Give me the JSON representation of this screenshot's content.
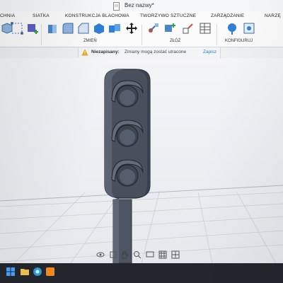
{
  "window": {
    "title": "Bez nazwy*"
  },
  "ribbon": {
    "tabs": [
      "CHNIA",
      "SIATKA",
      "KONSTRUKCJA BLACHOWA",
      "TWORZYWO SZTUCZNE",
      "ZARZĄDZANIE",
      "NARZĘ"
    ],
    "groups": {
      "modify": "ZMIEŃ",
      "assemble": "ZŁÓŻ",
      "configure": "KONFIGURUJ"
    }
  },
  "notification": {
    "title": "Niezapisany:",
    "message": "Zmiany mogą zostać utracone",
    "action": "Zapisz"
  },
  "colors": {
    "accent": "#2d7bd1",
    "model": "#4a5361",
    "taskbar": "#23272d"
  }
}
